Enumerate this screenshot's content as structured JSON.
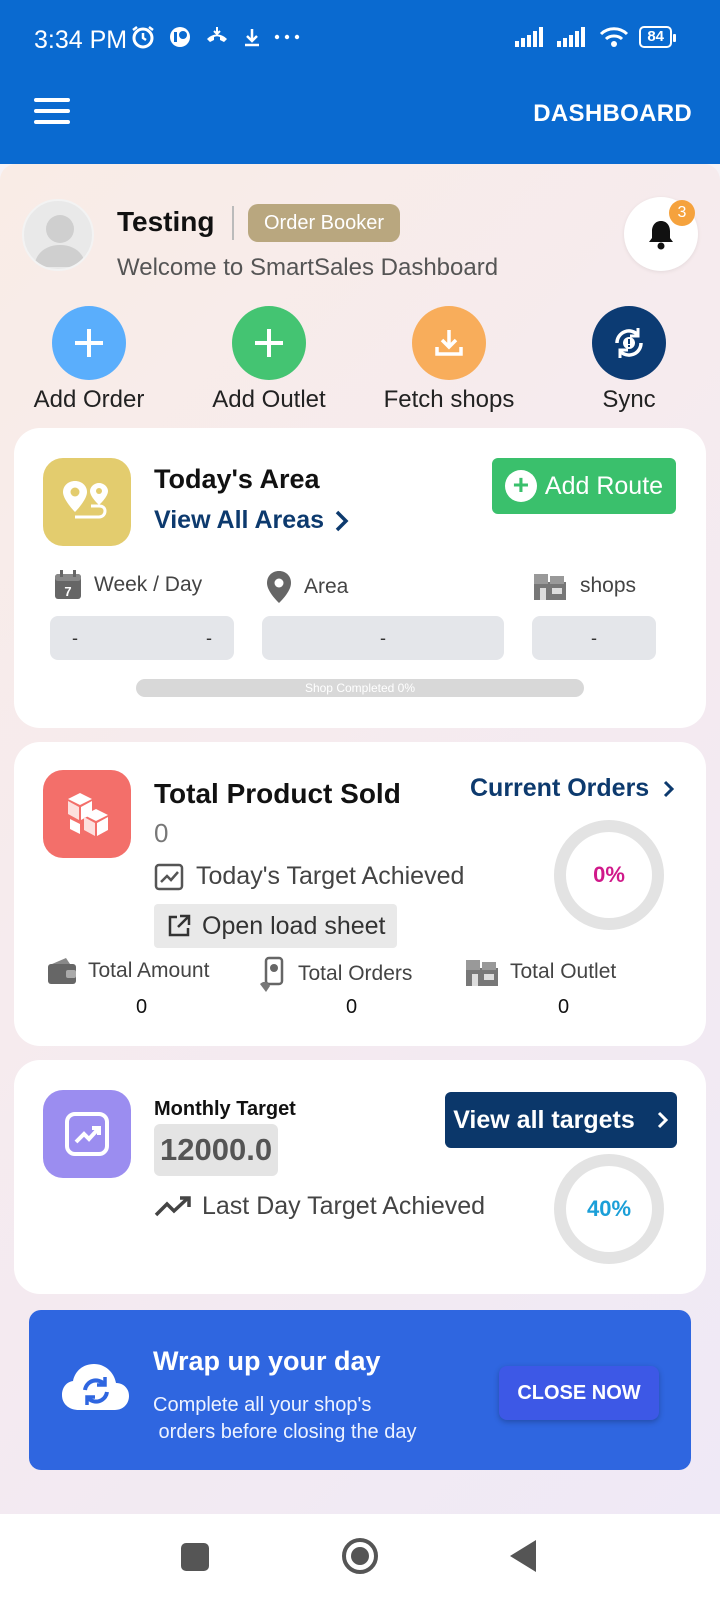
{
  "status_bar": {
    "time": "3:34 PM",
    "battery": "84",
    "icons": [
      "alarm-icon",
      "app-icon",
      "call-icon",
      "download-icon",
      "more-icon",
      "signal-icon",
      "signal-icon",
      "wifi-icon",
      "battery-icon"
    ]
  },
  "app_bar": {
    "title": "DASHBOARD",
    "menu_icon": "hamburger-icon"
  },
  "profile": {
    "name": "Testing",
    "role": "Order Booker",
    "welcome": "Welcome to SmartSales Dashboard",
    "notification_count": "3"
  },
  "quick_actions": [
    {
      "label": "Add Order",
      "icon": "plus-icon",
      "color": "#5aaefc"
    },
    {
      "label": "Add Outlet",
      "icon": "plus-icon",
      "color": "#44c472"
    },
    {
      "label": "Fetch shops",
      "icon": "download-icon",
      "color": "#f8ad5b"
    },
    {
      "label": "Sync",
      "icon": "sync-icon",
      "color": "#0c3b73"
    }
  ],
  "today_area": {
    "title": "Today's Area",
    "link": "View All Areas",
    "add_route": "Add Route",
    "labels": {
      "week_day": "Week / Day",
      "area": "Area",
      "shops": "shops"
    },
    "calendar_day": "7",
    "values": {
      "week": "-",
      "day": "-",
      "area": "-",
      "shops": "-"
    },
    "progress_text": "Shop Completed 0%",
    "progress": 0
  },
  "product_sold": {
    "title": "Total Product Sold",
    "value": "0",
    "current_orders": "Current Orders",
    "target_label": "Today's Target Achieved",
    "percent": "0%",
    "open_sheet": "Open load sheet",
    "stats": [
      {
        "label": "Total Amount",
        "value": "0"
      },
      {
        "label": "Total Orders",
        "value": "0"
      },
      {
        "label": "Total Outlet",
        "value": "0"
      }
    ]
  },
  "monthly_target": {
    "title": "Monthly Target",
    "value": "12000.0",
    "view_all": "View all targets",
    "last_day_label": "Last Day Target Achieved",
    "percent": "40%"
  },
  "wrap_up": {
    "title": "Wrap up your day",
    "subtitle": "Complete all your shop's\n orders before closing the day",
    "button": "CLOSE NOW"
  },
  "colors": {
    "app_bar": "#0a6ad0",
    "accent_green": "#3ac06c",
    "navy": "#0b376a",
    "magenta": "#d0198a",
    "cyan": "#1b9fd8",
    "wrap_blue": "#2f66e0"
  }
}
